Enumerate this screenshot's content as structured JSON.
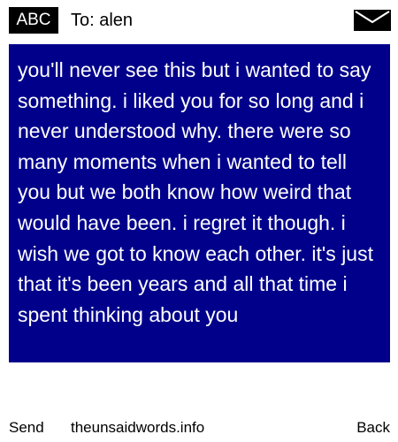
{
  "header": {
    "input_mode": "ABC",
    "recipient_label": "To: alen",
    "envelope_icon": "envelope-icon"
  },
  "message": {
    "body": "you'll never see this but i wanted to say something. i liked you for so long and i never understood why. there were so many moments when i wanted to tell you but we both know how weird that would have been. i regret it though. i wish we got to know each other. it's just that it's been years and all that time i spent thinking about you"
  },
  "footer": {
    "send_label": "Send",
    "site_label": "theunsaidwords.info",
    "back_label": "Back"
  },
  "colors": {
    "message_background": "#00008b",
    "message_text": "#ffffff",
    "badge_background": "#000000"
  }
}
